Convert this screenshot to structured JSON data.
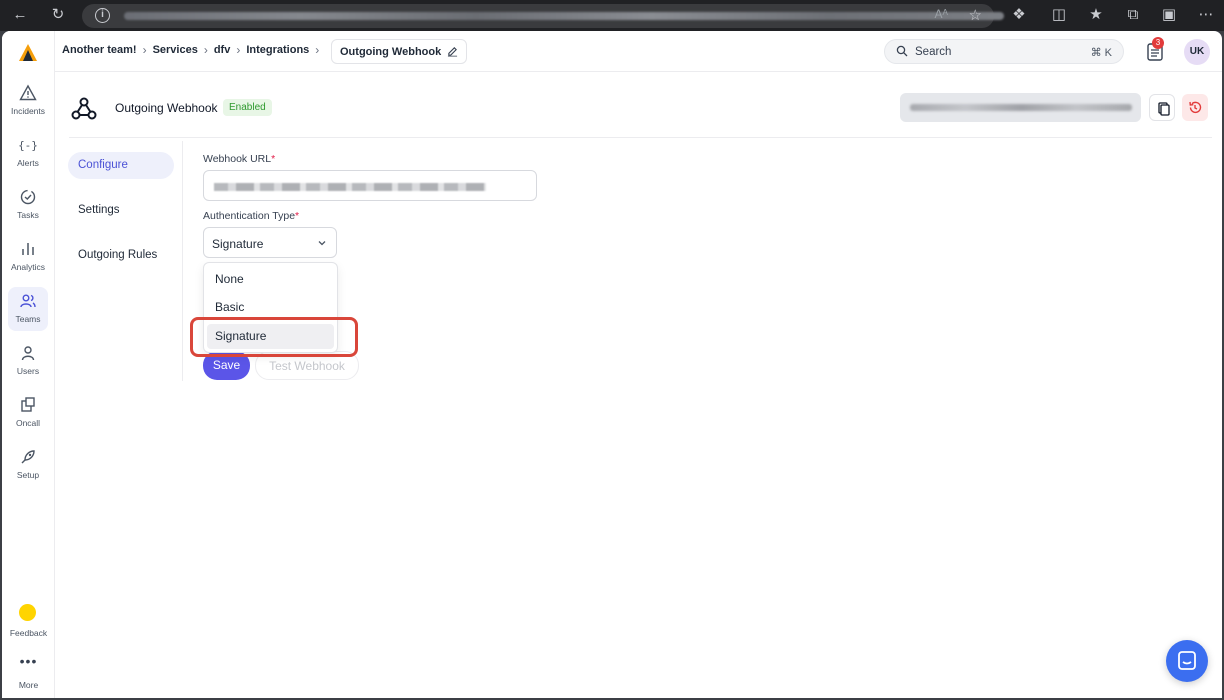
{
  "browser": {
    "back_icon": "back-arrow-icon",
    "reload_icon": "reload-icon",
    "reader_label": "Aᴬ"
  },
  "sidebar": {
    "items": [
      {
        "label": "Incidents",
        "icon": "alert-triangle-icon"
      },
      {
        "label": "Alerts",
        "icon": "braces-icon"
      },
      {
        "label": "Tasks",
        "icon": "check-circle-icon"
      },
      {
        "label": "Analytics",
        "icon": "bar-chart-icon"
      },
      {
        "label": "Teams",
        "icon": "users-icon"
      },
      {
        "label": "Users",
        "icon": "user-icon"
      },
      {
        "label": "Oncall",
        "icon": "oncall-icon"
      },
      {
        "label": "Setup",
        "icon": "rocket-icon"
      },
      {
        "label": "Feedback",
        "icon": "feedback-dot-icon"
      },
      {
        "label": "More",
        "icon": "more-dots-icon"
      }
    ]
  },
  "header": {
    "breadcrumbs": [
      "Another team!",
      "Services",
      "dfv",
      "Integrations"
    ],
    "current": "Outgoing Webhook",
    "search_placeholder": "Search",
    "search_shortcut": "⌘ K",
    "notification_count": "3",
    "avatar_initials": "UK"
  },
  "page": {
    "title": "Outgoing Webhook",
    "status": "Enabled",
    "tabs": [
      "Configure",
      "Settings",
      "Outgoing Rules"
    ],
    "active_tab": "Configure"
  },
  "form": {
    "webhook_url_label": "Webhook URL",
    "auth_type_label": "Authentication Type",
    "required_mark": "*",
    "auth_type_value": "Signature",
    "auth_options": [
      "None",
      "Basic",
      "Signature"
    ],
    "save_label": "Save",
    "test_label": "Test Webhook"
  },
  "colors": {
    "accent": "#5b55e8",
    "enabled_badge": "#2f9a2f",
    "highlight": "#d9463a",
    "chat": "#3b6ef0"
  }
}
